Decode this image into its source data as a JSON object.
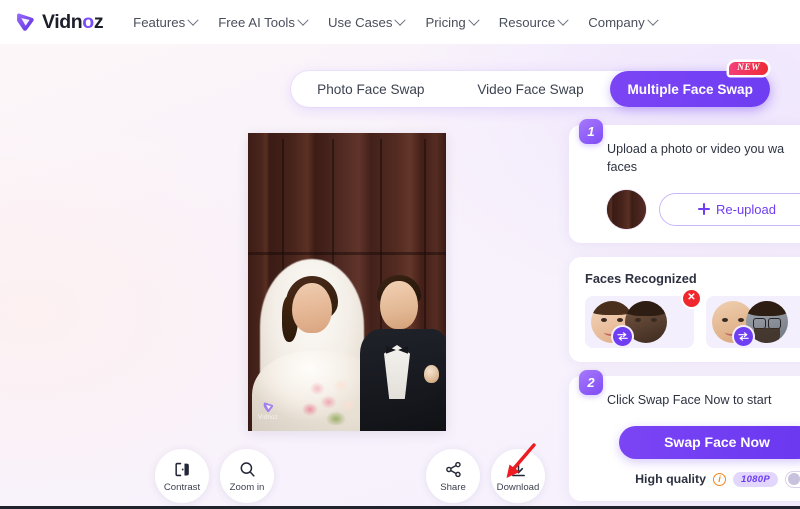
{
  "header": {
    "logo_text_main": "Vidn",
    "logo_text_accent": "o",
    "logo_text_tail": "z",
    "nav": [
      {
        "label": "Features"
      },
      {
        "label": "Free AI Tools"
      },
      {
        "label": "Use Cases"
      },
      {
        "label": "Pricing"
      },
      {
        "label": "Resource"
      },
      {
        "label": "Company"
      }
    ]
  },
  "tabs": [
    {
      "label": "Photo Face Swap",
      "active": false
    },
    {
      "label": "Video Face Swap",
      "active": false
    },
    {
      "label": "Multiple Face Swap",
      "active": true,
      "badge": "NEW"
    }
  ],
  "step1": {
    "number": "1",
    "text": "Upload a photo or video you wa faces",
    "reupload_label": "Re-upload"
  },
  "faces": {
    "title": "Faces Recognized",
    "pairs": [
      {
        "delete_label": "✕"
      },
      {
        "delete_label": "✕"
      }
    ]
  },
  "step2": {
    "number": "2",
    "text": "Click Swap Face Now to start",
    "button_label": "Swap Face Now",
    "quality_label": "High quality",
    "quality_badge": "1080P",
    "info_glyph": "i"
  },
  "toolbar": [
    {
      "label": "Contrast",
      "icon": "contrast-icon"
    },
    {
      "label": "Zoom in",
      "icon": "zoom-in-icon"
    },
    {
      "label": "Share",
      "icon": "share-icon"
    },
    {
      "label": "Download",
      "icon": "download-icon"
    }
  ],
  "watermark": {
    "text": "Vidnoz"
  },
  "colors": {
    "brand_purple": "#6f3df2",
    "badge_red": "#ee2b33",
    "accent_orange": "#f5851f",
    "lavender": "#e3d6fd"
  }
}
